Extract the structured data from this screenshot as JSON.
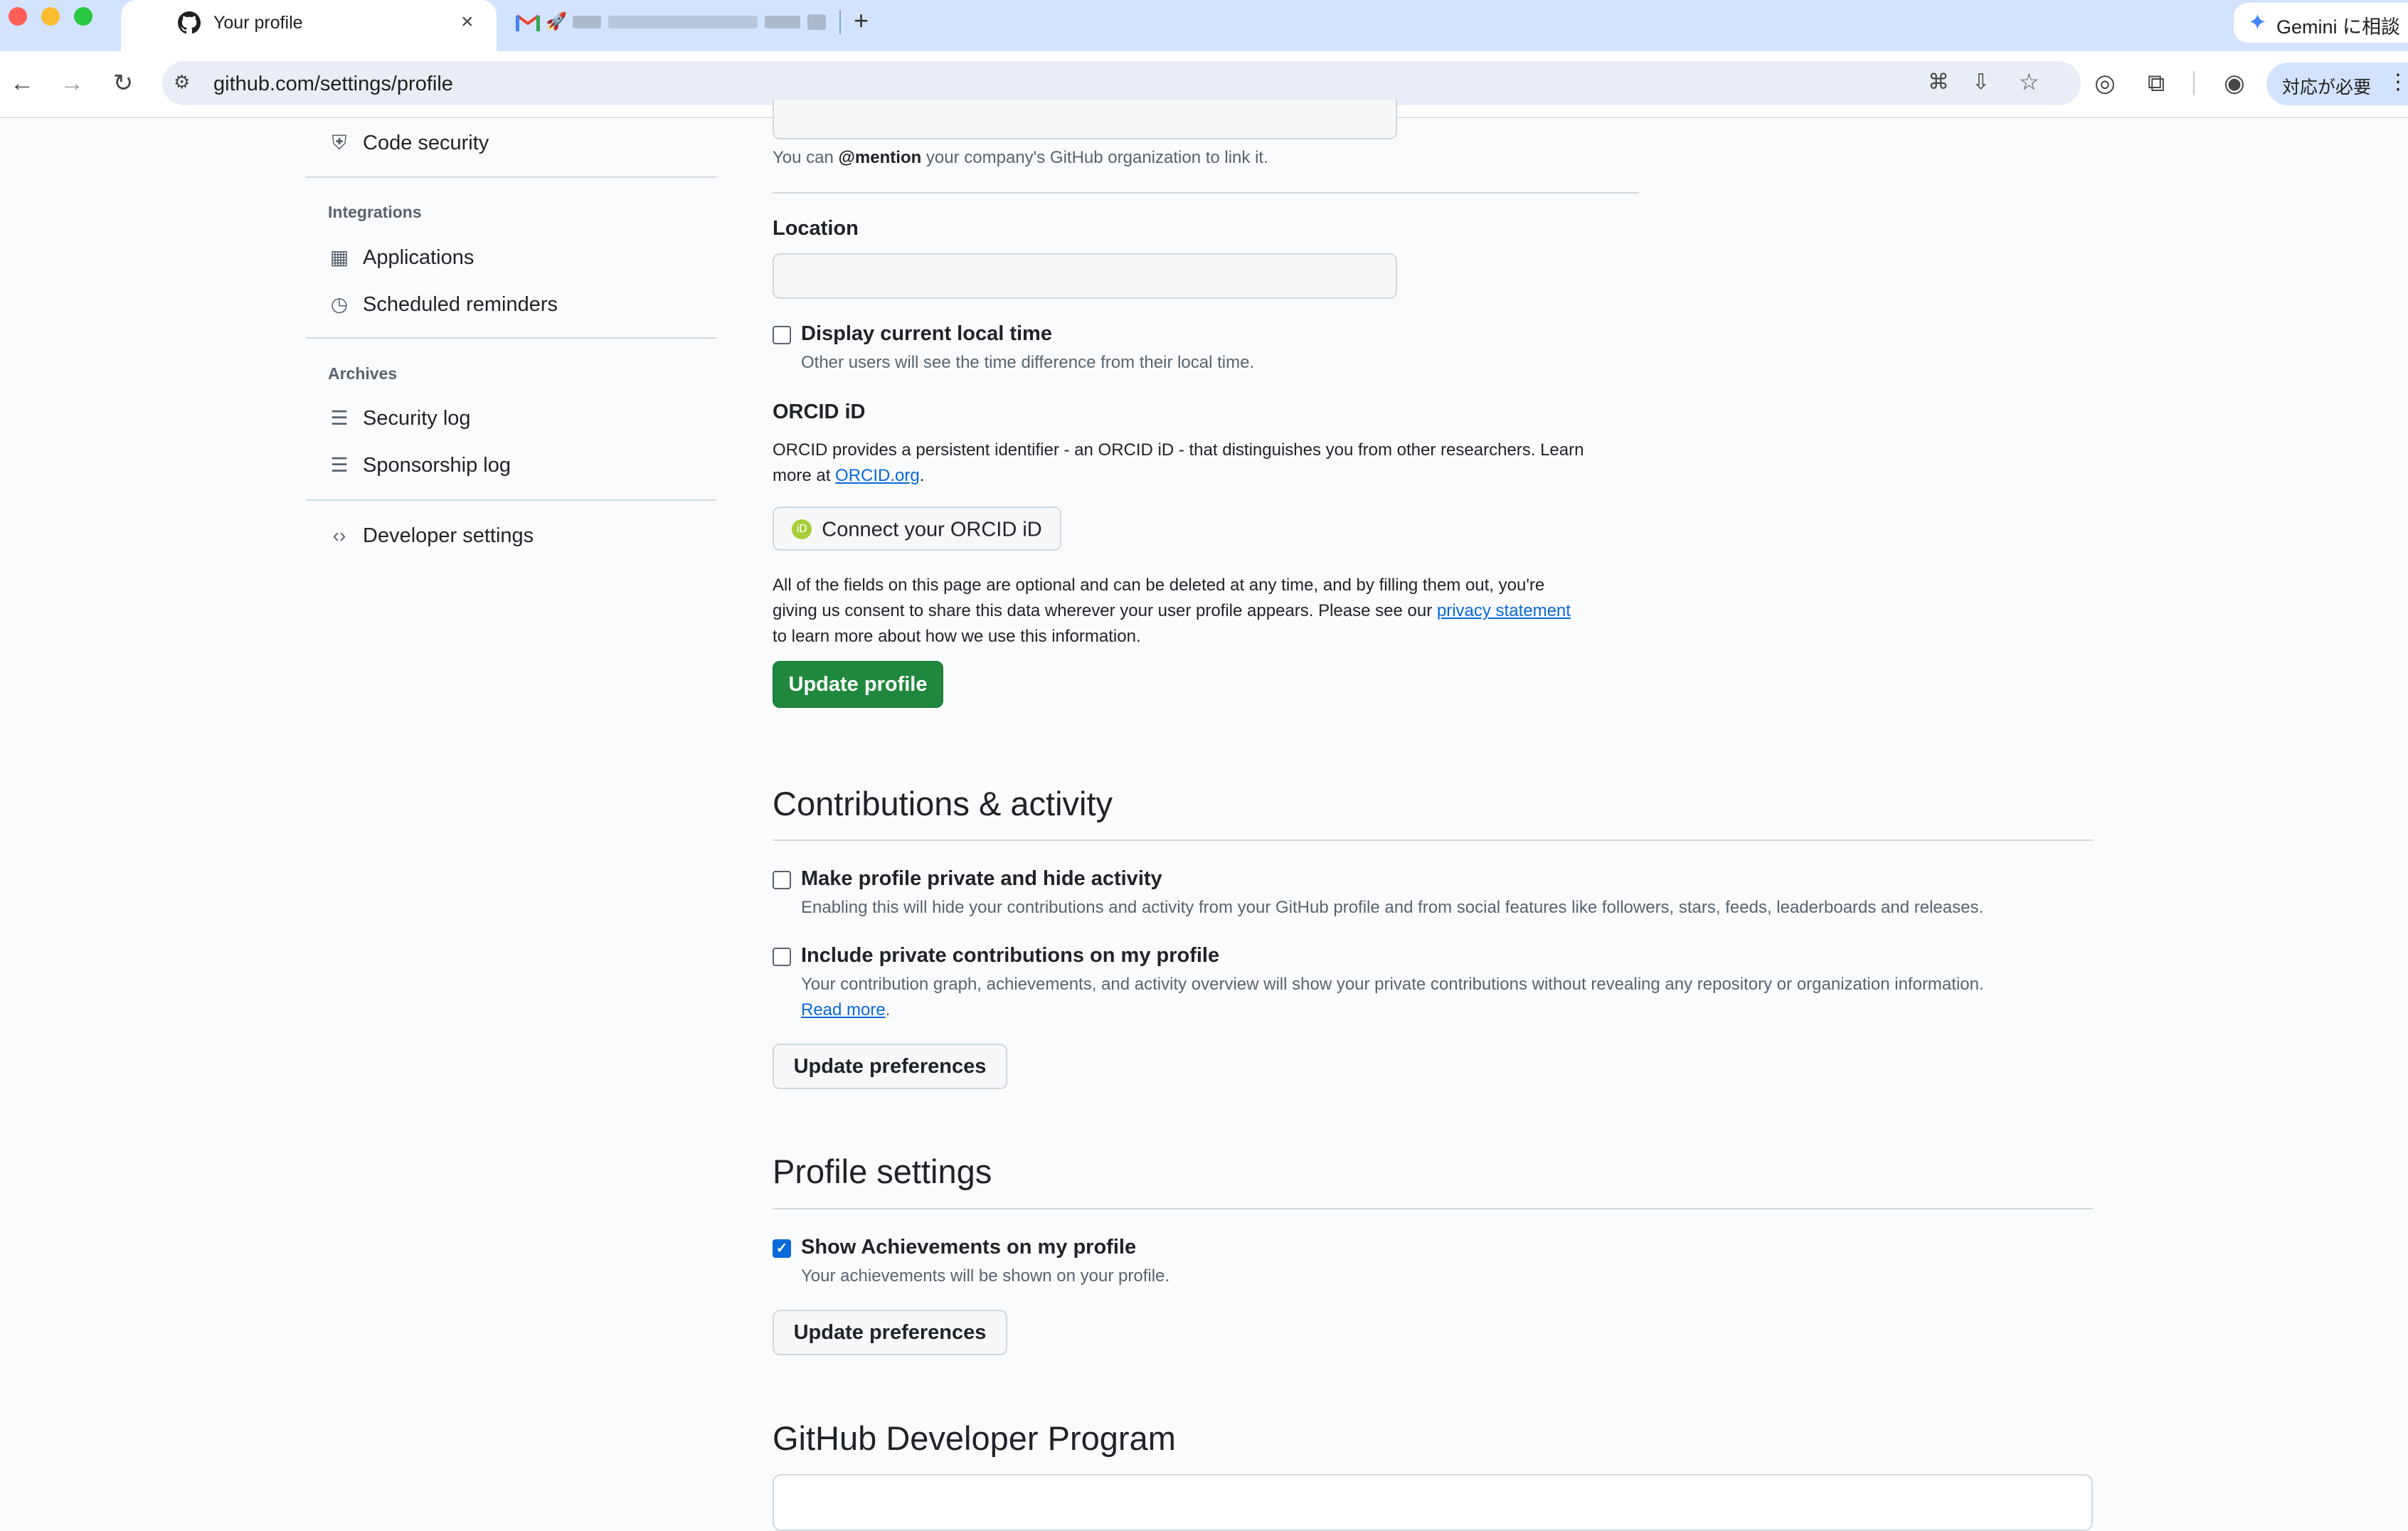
{
  "browser": {
    "tabs": [
      {
        "label": "Your profile",
        "active": true
      },
      {
        "label": "",
        "active": false
      }
    ],
    "gemini_label": "Gemini に相談",
    "url": "github.com/settings/profile",
    "status_chip": "対応が必要"
  },
  "sidebar": {
    "code_security": "Code security",
    "integrations_heading": "Integrations",
    "applications": "Applications",
    "scheduled_reminders": "Scheduled reminders",
    "archives_heading": "Archives",
    "security_log": "Security log",
    "sponsorship_log": "Sponsorship log",
    "developer_settings": "Developer settings"
  },
  "company": {
    "hint_pre": "You can ",
    "hint_mention": "@mention",
    "hint_post": " your company's GitHub organization to link it."
  },
  "location": {
    "label": "Location",
    "value": "",
    "display_time_label": "Display current local time",
    "display_time_desc": "Other users will see the time difference from their local time.",
    "display_time_checked": false
  },
  "orcid": {
    "heading": "ORCID iD",
    "desc_line1": "ORCID provides a persistent identifier - an ORCID iD - that distinguishes you from other researchers. Learn",
    "desc_line2_pre": "more at ",
    "desc_link": "ORCID.org",
    "desc_line2_post": ".",
    "button": "Connect your ORCID iD"
  },
  "consent": {
    "line1": "All of the fields on this page are optional and can be deleted at any time, and by filling them out, you're",
    "line2_pre": "giving us consent to share this data wherever your user profile appears. Please see our ",
    "link": "privacy statement",
    "line3": "to learn more about how we use this information."
  },
  "update_profile_button": "Update profile",
  "contributions": {
    "title": "Contributions & activity",
    "private_label": "Make profile private and hide activity",
    "private_desc": "Enabling this will hide your contributions and activity from your GitHub profile and from social features like followers, stars, feeds, leaderboards and releases.",
    "private_checked": false,
    "include_label": "Include private contributions on my profile",
    "include_desc": "Your contribution graph, achievements, and activity overview will show your private contributions without revealing any repository or organization information.",
    "include_read_more": "Read more",
    "include_checked": false,
    "button": "Update preferences"
  },
  "profile_settings": {
    "title": "Profile settings",
    "achievements_label": "Show Achievements on my profile",
    "achievements_desc": "Your achievements will be shown on your profile.",
    "achievements_checked": true,
    "button": "Update preferences"
  },
  "developer_program": {
    "title": "GitHub Developer Program"
  },
  "colors": {
    "primary_green": "#1f883d",
    "link_blue": "#0969da",
    "chrome_blue": "#d3e3fd"
  }
}
